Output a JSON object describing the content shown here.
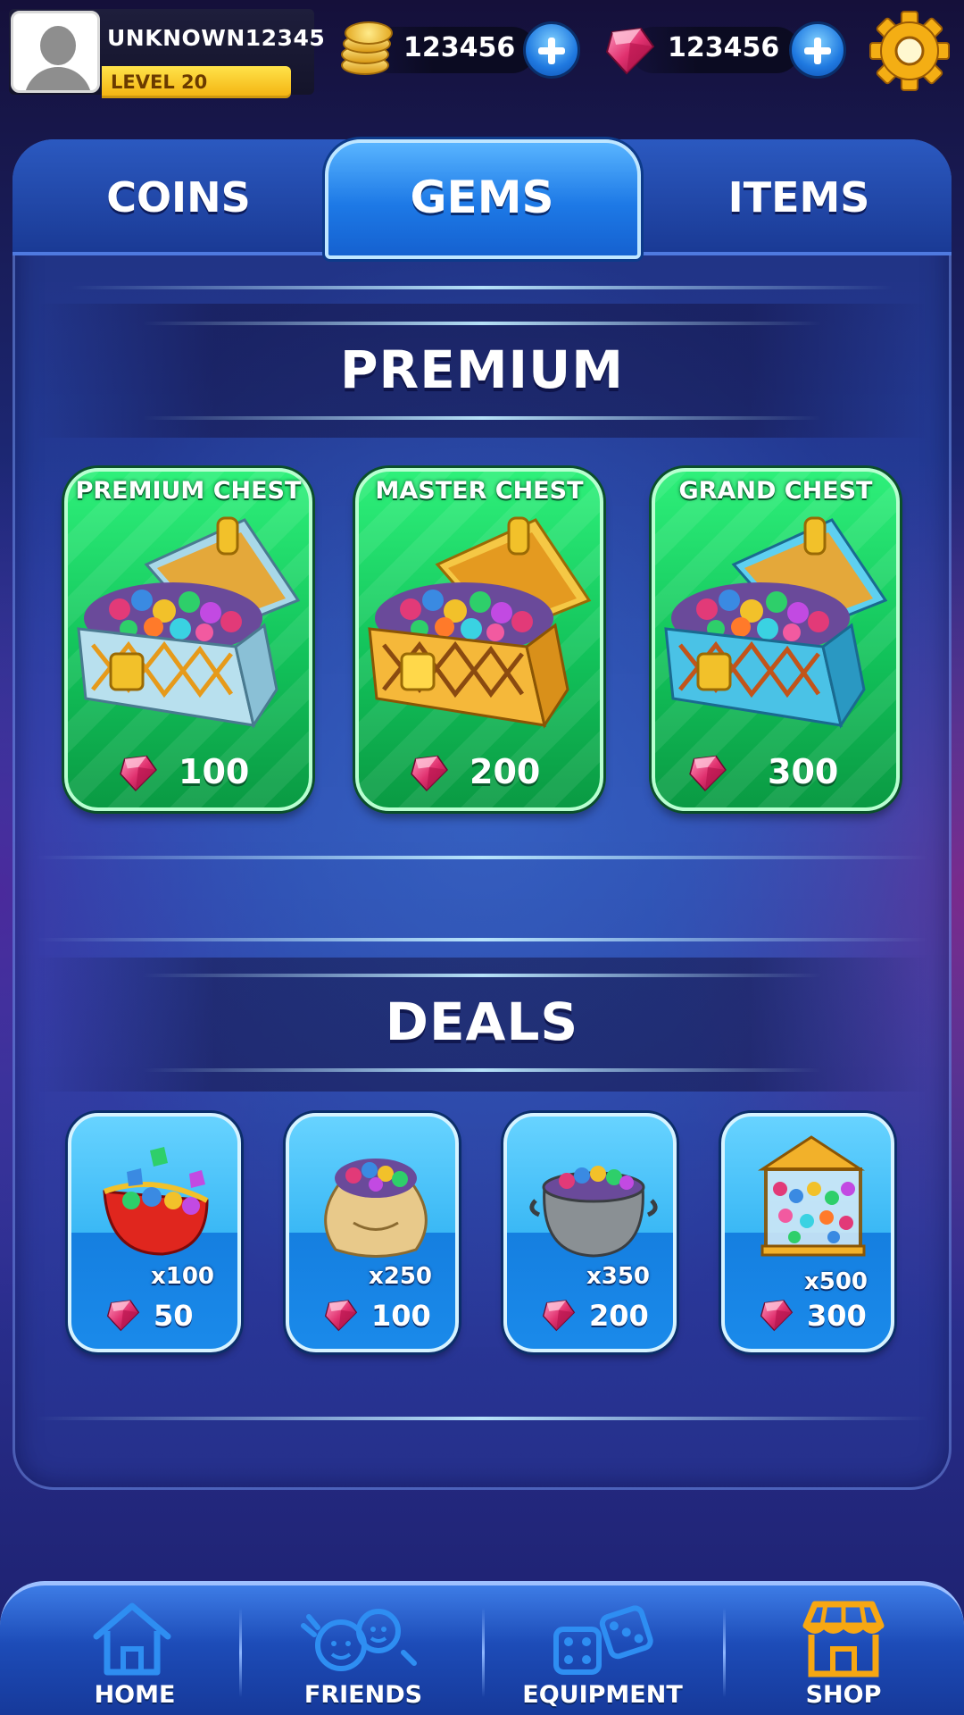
{
  "profile": {
    "username": "UNKNOWN12345",
    "level": "LEVEL 20"
  },
  "currencies": {
    "coins": "123456",
    "gems": "123456"
  },
  "tabs": [
    {
      "label": "COINS",
      "active": false
    },
    {
      "label": "GEMS",
      "active": true
    },
    {
      "label": "ITEMS",
      "active": false
    }
  ],
  "premium": {
    "title": "PREMIUM",
    "chests": [
      {
        "name": "PREMIUM CHEST",
        "price": "100",
        "style": "silver"
      },
      {
        "name": "MASTER CHEST",
        "price": "200",
        "style": "gold"
      },
      {
        "name": "GRAND CHEST",
        "price": "300",
        "style": "blue"
      }
    ]
  },
  "deals": {
    "title": "DEALS",
    "items": [
      {
        "icon": "gem-purse-icon",
        "quantity": "x100",
        "price": "50"
      },
      {
        "icon": "gem-sack-icon",
        "quantity": "x250",
        "price": "100"
      },
      {
        "icon": "gem-cauldron-icon",
        "quantity": "x350",
        "price": "200"
      },
      {
        "icon": "gem-crate-icon",
        "quantity": "x500",
        "price": "300"
      }
    ]
  },
  "nav": [
    {
      "label": "HOME",
      "icon": "home-icon"
    },
    {
      "label": "FRIENDS",
      "icon": "friends-icon"
    },
    {
      "label": "EQUIPMENT",
      "icon": "dice-icon"
    },
    {
      "label": "SHOP",
      "icon": "shop-icon",
      "active": true
    }
  ],
  "colors": {
    "active_nav": "#f7a712",
    "chest_green": "#12c25a",
    "deal_blue": "#1a8aea",
    "gem": "#e23a78"
  }
}
